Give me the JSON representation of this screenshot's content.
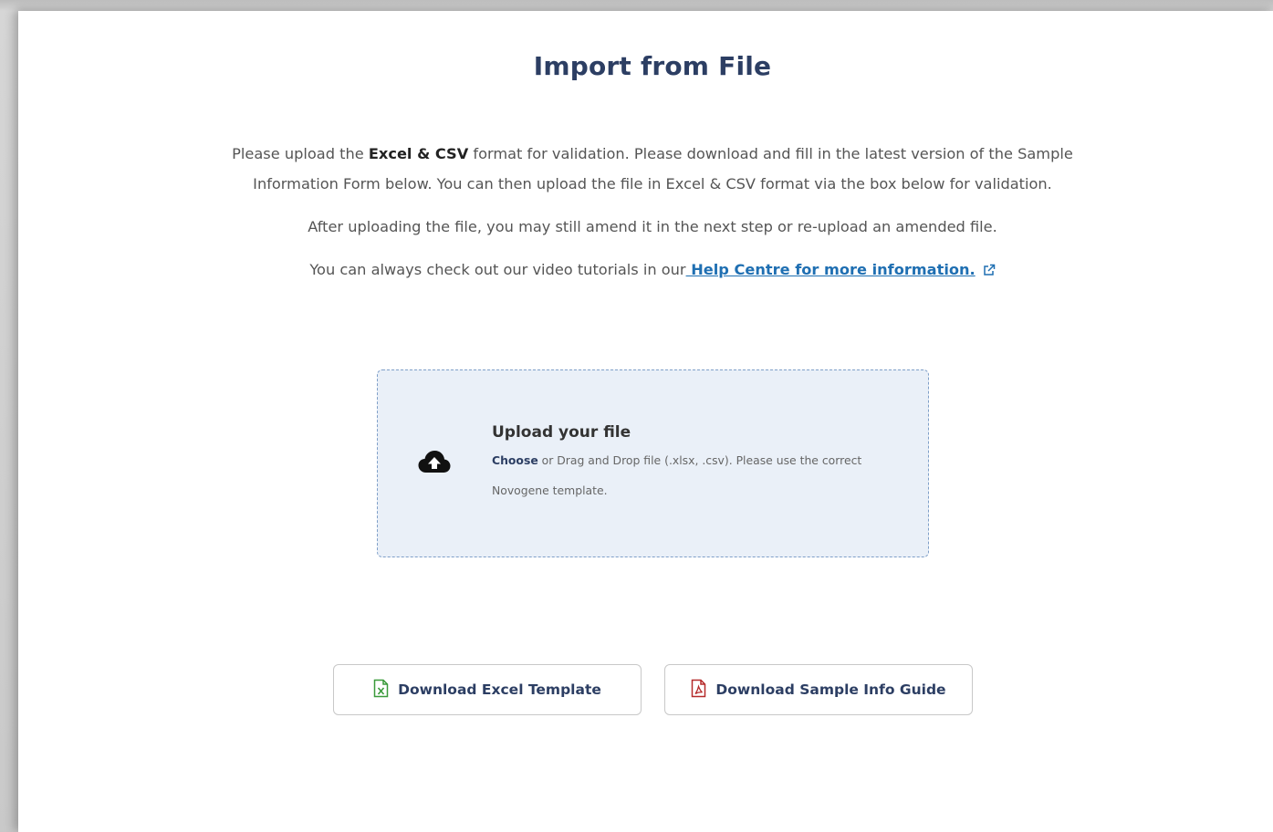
{
  "header": {
    "title": "Import from File"
  },
  "intro": {
    "line1_prefix": "Please upload the ",
    "line1_bold": "Excel & CSV",
    "line1_suffix": " format for validation. Please download and fill in the latest version of the Sample Information Form below. You can then upload the file in Excel & CSV format via the box below for validation.",
    "line2": "After uploading the file, you may still amend it in the next step or re-upload an amended file.",
    "line3_prefix": "You can always check out our video tutorials in our",
    "help_link": " Help Centre for more information."
  },
  "upload": {
    "title": "Upload your file",
    "choose_label": "Choose",
    "description": " or Drag and Drop file (.xlsx, .csv). Please use the correct Novogene template."
  },
  "buttons": {
    "excel_template": "Download Excel Template",
    "sample_guide": "Download Sample Info Guide"
  },
  "colors": {
    "title": "#2c3e63",
    "link": "#1f6fb2",
    "dropzone_bg": "#eaf0f8",
    "excel_icon": "#3a9a3a",
    "pdf_icon": "#b52a2a"
  },
  "icons": {
    "external_link": "external-link-icon",
    "upload": "cloud-upload-icon",
    "excel": "excel-file-icon",
    "pdf": "pdf-file-icon"
  }
}
